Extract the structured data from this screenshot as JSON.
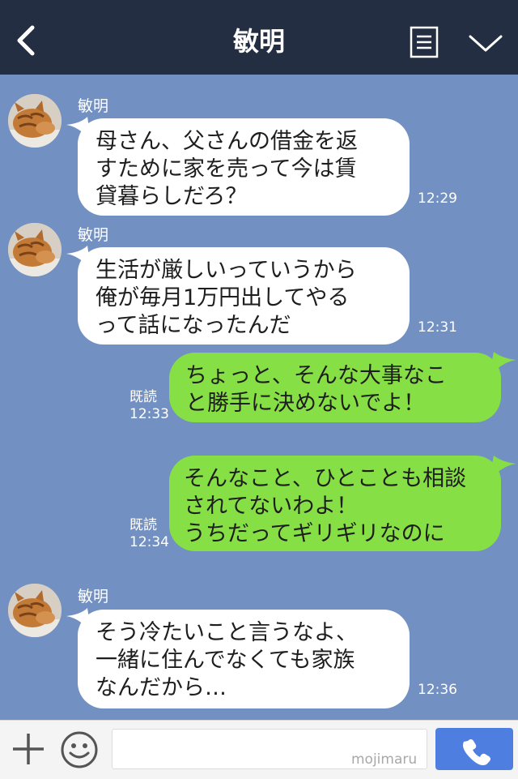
{
  "header": {
    "title": "敏明"
  },
  "messages": [
    {
      "sender": "敏明",
      "text": "母さん、父さんの借金を返\nすために家を売って今は賃\n貸暮らしだろ？",
      "time": "12:29"
    },
    {
      "sender": "敏明",
      "text": "生活が厳しいっていうから\n俺が毎月1万円出してやる\nって話になったんだ",
      "time": "12:31"
    },
    {
      "read": "既読",
      "text": "ちょっと、そんな大事なこ\nと勝手に決めないでよ！",
      "time": "12:33"
    },
    {
      "read": "既読",
      "text": "そんなこと、ひとことも相談\nされてないわよ！\nうちだってギリギリなのに",
      "time": "12:34"
    },
    {
      "sender": "敏明",
      "text": "そう冷たいこと言うなよ、\n一緒に住んでなくても家族\nなんだから…",
      "time": "12:36"
    }
  ],
  "footer": {
    "watermark": "mojimaru"
  },
  "icons": {
    "back": "chevron-left-icon",
    "menu": "notes-icon",
    "collapse": "chevron-down-icon",
    "add": "plus-icon",
    "emoji": "smiley-icon",
    "call": "phone-icon"
  },
  "colors": {
    "header": "#242e42",
    "chat_background": "#7291c2",
    "incoming_bubble": "#ffffff",
    "outgoing_bubble": "#86df45",
    "call_button": "#4e7fe0"
  }
}
